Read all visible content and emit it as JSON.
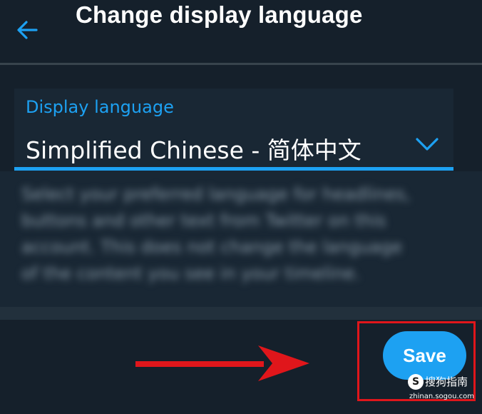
{
  "header": {
    "title": "Change display language",
    "back_icon": "arrow-left-icon"
  },
  "field": {
    "label": "Display language",
    "value": "Simplified Chinese - 简体中文",
    "chevron_icon": "chevron-down-icon"
  },
  "help": {
    "text": "Select your preferred language for headlines, buttons and other text from Twitter on this account. This does not change the language of the content you see in your timeline."
  },
  "actions": {
    "save_label": "Save"
  },
  "annotation": {
    "arrow_icon": "arrow-right-icon",
    "highlight_color": "#e0161b"
  },
  "watermark": {
    "glyph": "S",
    "name": "搜狗指南",
    "url": "zhinan.sogou.com"
  },
  "colors": {
    "background": "#15202b",
    "accent": "#1da1f2",
    "surface": "#192734"
  }
}
